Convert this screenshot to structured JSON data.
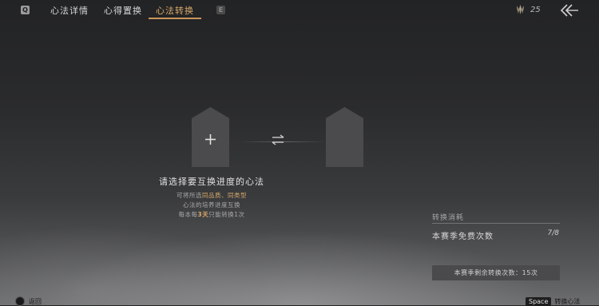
{
  "top_bar": {
    "left_key": "Q",
    "right_key": "E",
    "tabs": [
      {
        "label": "心法详情",
        "active": false
      },
      {
        "label": "心得置换",
        "active": false
      },
      {
        "label": "心法转换",
        "active": true
      }
    ],
    "currency": {
      "icon": "feather-icon",
      "value": "25"
    },
    "back_icon": "double-chevron-back-icon"
  },
  "conversion": {
    "left_slot_icon": "plus-icon",
    "swap_icon": "swap-arrows-icon",
    "prompt": "请选择要互换进度的心法",
    "desc_line1_prefix": "可将所选",
    "desc_line1_highlight": "同品质、同类型",
    "desc_line2": "心法的培养进度互换",
    "desc_line3_prefix": "每本每",
    "desc_line3_highlight": "3天",
    "desc_line3_suffix": "只能转换1次"
  },
  "cost_panel": {
    "title": "转换消耗",
    "label": "本赛季免费次数",
    "value": "7/8",
    "remaining_text": "本赛季剩余转换次数：15次"
  },
  "bottom_bar": {
    "return_label": "返回",
    "space_key": "Space",
    "space_action": "转换心法"
  },
  "colors": {
    "accent": "#d8a96a",
    "slot": "#4b4b4d"
  }
}
